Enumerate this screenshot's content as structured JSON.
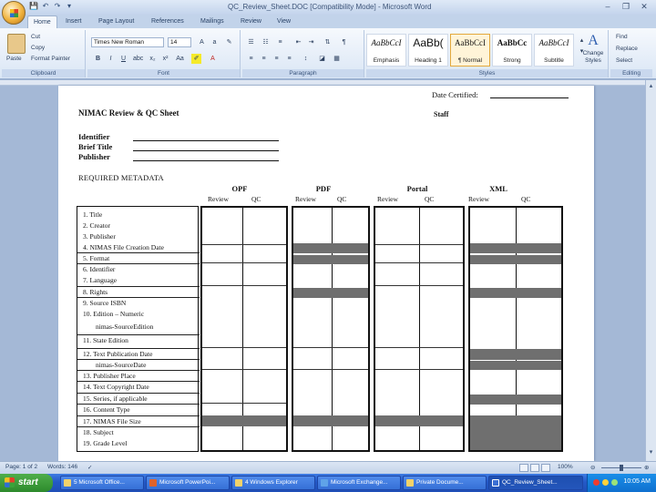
{
  "window": {
    "title": "QC_Review_Sheet.DOC [Compatibility Mode] - Microsoft Word",
    "minimize": "–",
    "restore": "❐",
    "close": "✕"
  },
  "quick_access": {
    "save": "💾",
    "undo": "↶",
    "redo": "↷",
    "more": "▾"
  },
  "tabs": [
    "Home",
    "Insert",
    "Page Layout",
    "References",
    "Mailings",
    "Review",
    "View"
  ],
  "ribbon": {
    "clipboard": {
      "label": "Clipboard",
      "paste": "Paste",
      "cut": "Cut",
      "copy": "Copy",
      "format_painter": "Format Painter"
    },
    "font": {
      "label": "Font",
      "family": "Times New Roman",
      "size": "14",
      "bold": "B",
      "italic": "I",
      "underline": "U"
    },
    "paragraph": {
      "label": "Paragraph",
      "pilcrow": "¶"
    },
    "styles": {
      "label": "Styles",
      "items": [
        {
          "sample": "AaBbCcI",
          "name": "Emphasis"
        },
        {
          "sample": "AaBb(",
          "name": "Heading 1"
        },
        {
          "sample": "AaBbCcI",
          "name": "¶ Normal"
        },
        {
          "sample": "AaBbCc",
          "name": "Strong"
        },
        {
          "sample": "AaBbCcI",
          "name": "Subtitle"
        }
      ],
      "change_styles": "Change Styles",
      "change_glyph": "A"
    },
    "editing": {
      "label": "Editing",
      "find": "Find",
      "replace": "Replace",
      "select": "Select"
    }
  },
  "document": {
    "date_certified": "Date Certified:",
    "title": "NIMAC Review & QC Sheet",
    "staff": "Staff",
    "fields": [
      "Identifier",
      "Brief Title",
      "Publisher"
    ],
    "required_metadata": "REQUIRED METADATA",
    "columns": [
      {
        "name": "OPF",
        "sub": [
          "Review",
          "QC"
        ]
      },
      {
        "name": "PDF",
        "sub": [
          "Review",
          "QC"
        ]
      },
      {
        "name": "Portal",
        "sub": [
          "Review",
          "QC"
        ]
      },
      {
        "name": "XML",
        "sub": [
          "Review",
          "QC"
        ]
      }
    ],
    "rows": [
      "1.   Title",
      "2.   Creator",
      "3.   Publisher",
      "4.   NIMAS File Creation Date",
      "5.   Format",
      "6.   Identifier",
      "7.   Language",
      "8.   Rights",
      "9.   Source ISBN",
      "10.  Edition – Numeric",
      "nimas-SourceEdition",
      "11.  State Edition",
      "12.  Text Publication Date",
      "nimas-SourceDate",
      "13.  Publisher Place",
      "14.  Text Copyright Date",
      "15.  Series, if applicable",
      "16.  Content Type",
      "17.  NIMAS File Size",
      "18.  Subject",
      "19.  Grade Level"
    ]
  },
  "status": {
    "page": "Page: 1 of 2",
    "words": "Words: 146",
    "zoom": "100%"
  },
  "taskbar": {
    "start": "start",
    "items": [
      "5 Microsoft Office...",
      "Microsoft PowerPoi...",
      "4 Windows Explorer",
      "Microsoft Exchange...",
      "Private Docume...",
      "QC_Review_Sheet..."
    ],
    "clock": "10:05 AM"
  }
}
